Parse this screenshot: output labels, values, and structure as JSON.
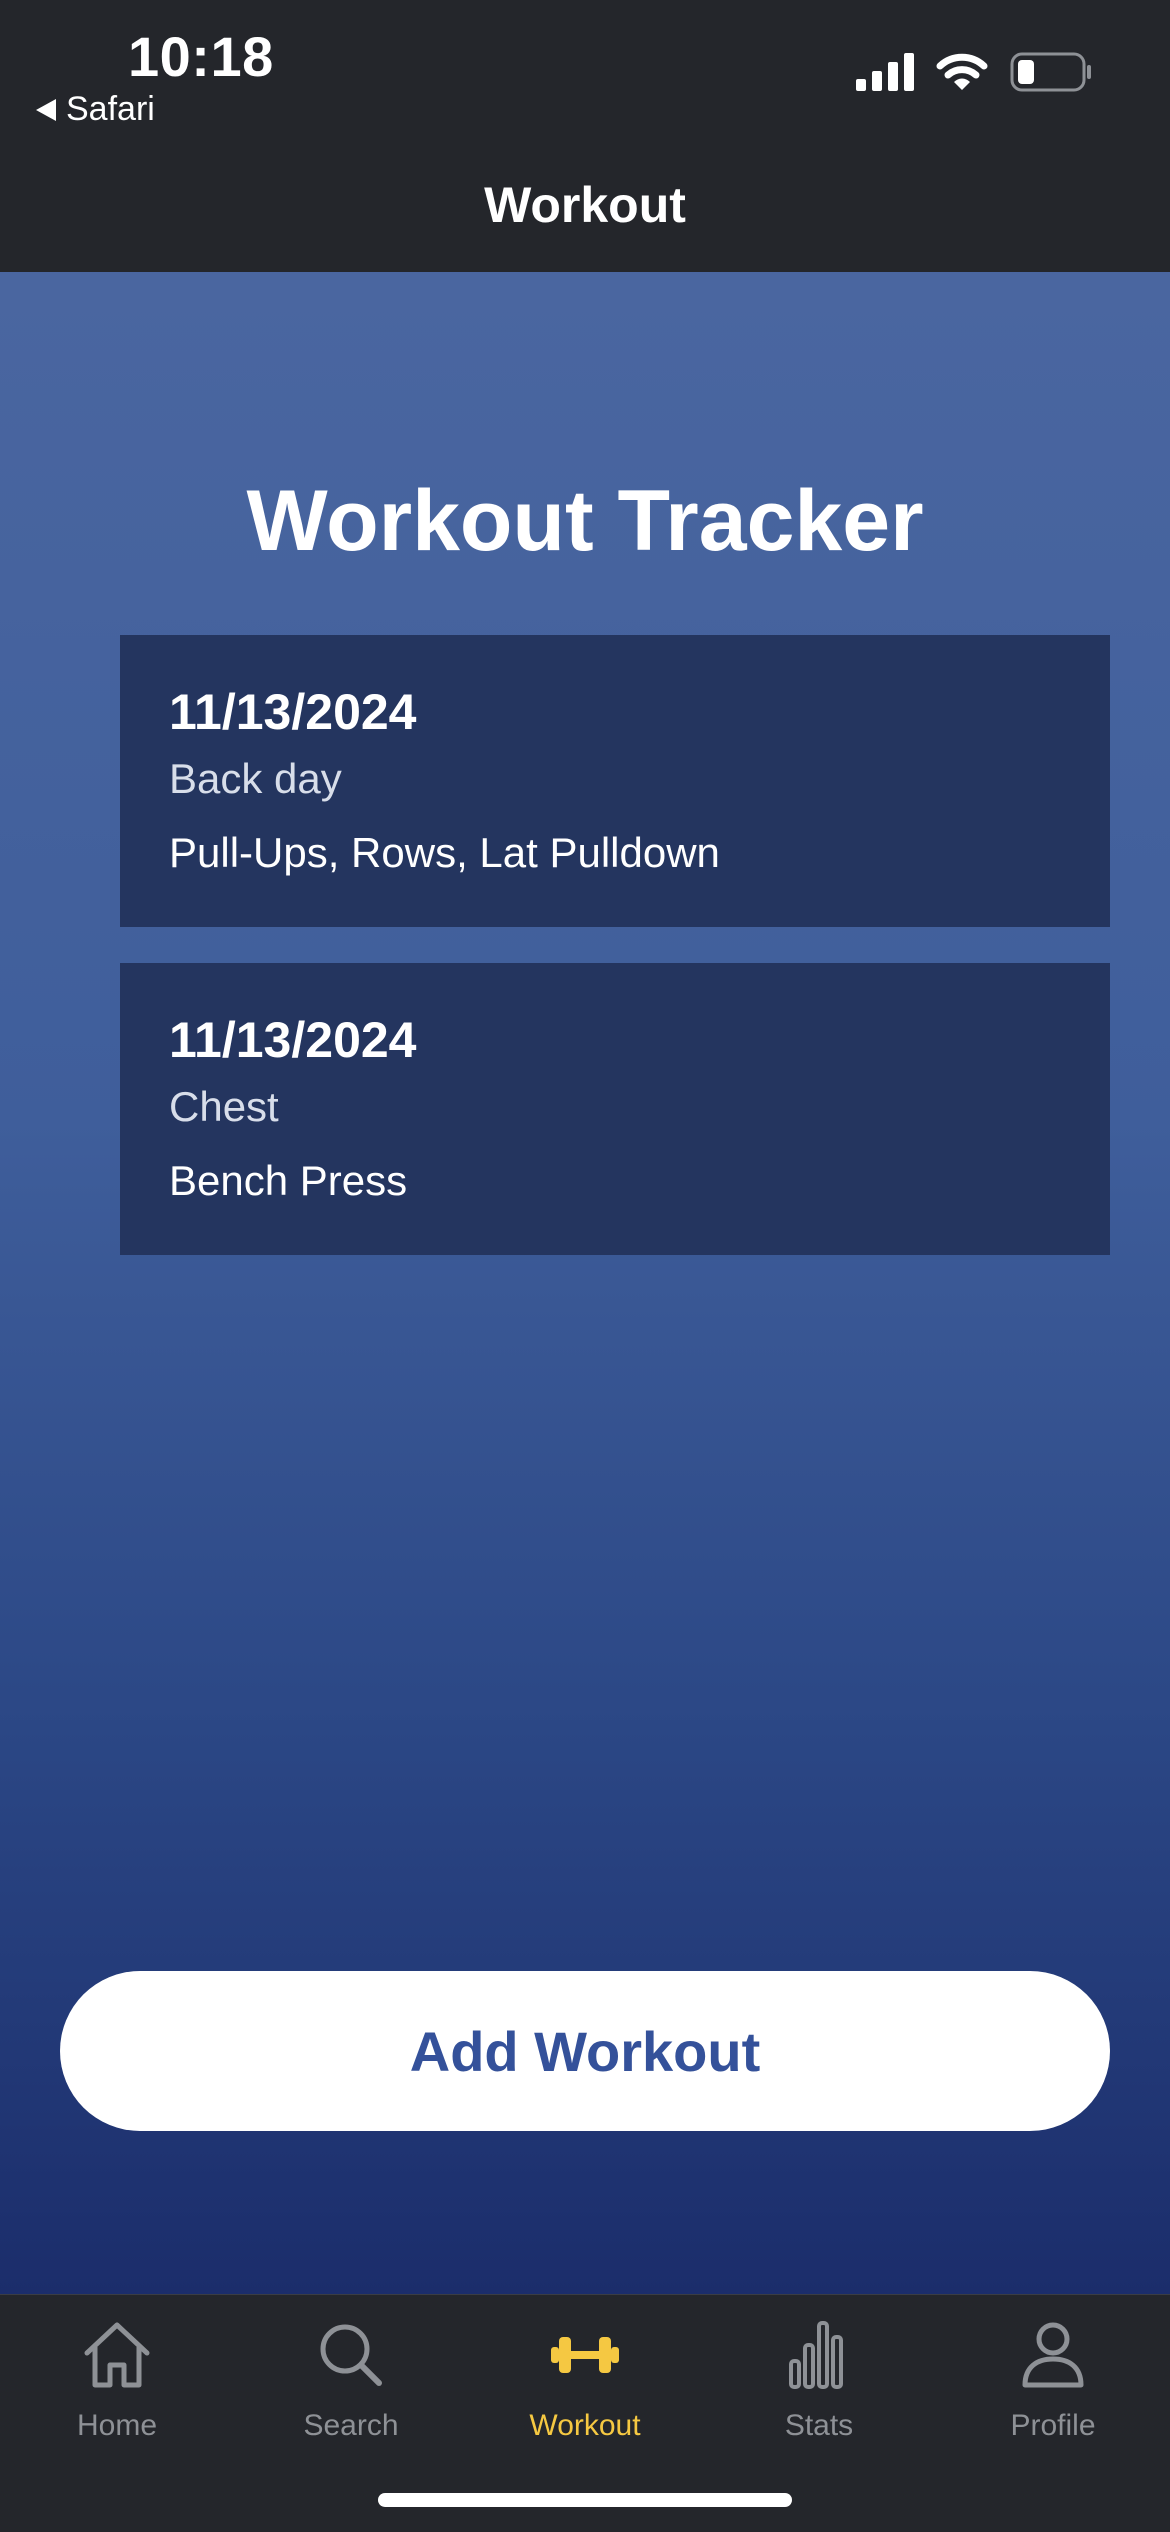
{
  "status_bar": {
    "time": "10:18",
    "back_app": "Safari"
  },
  "nav": {
    "title": "Workout"
  },
  "main": {
    "title": "Workout Tracker",
    "workouts": [
      {
        "date": "11/13/2024",
        "name": "Back day",
        "exercises": "Pull-Ups, Rows, Lat Pulldown"
      },
      {
        "date": "11/13/2024",
        "name": "Chest",
        "exercises": "Bench Press"
      }
    ],
    "add_button_label": "Add Workout"
  },
  "tabbar": {
    "items": [
      {
        "label": "Home",
        "icon": "home-icon"
      },
      {
        "label": "Search",
        "icon": "search-icon"
      },
      {
        "label": "Workout",
        "icon": "dumbbell-icon",
        "active": true
      },
      {
        "label": "Stats",
        "icon": "bar-chart-icon"
      },
      {
        "label": "Profile",
        "icon": "person-icon"
      }
    ],
    "active_color": "#f5c842",
    "inactive_color": "#8e9196"
  },
  "colors": {
    "header_bg": "#24262b",
    "card_bg": "#24355f",
    "button_text": "#34519a"
  }
}
